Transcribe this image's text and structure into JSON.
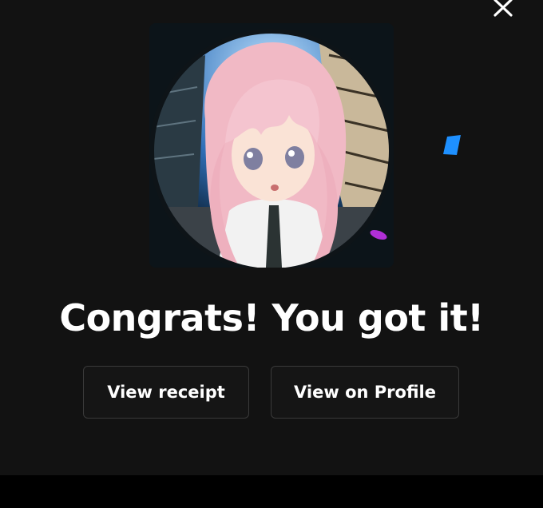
{
  "dialog": {
    "headline": "Congrats! You got it!",
    "close_icon": "close-icon"
  },
  "artwork": {
    "subject": "anime-girl-avatar"
  },
  "actions": {
    "view_receipt_label": "View receipt",
    "view_profile_label": "View on Profile"
  },
  "colors": {
    "background": "#121212",
    "text": "#ffffff",
    "button_border": "#3a3a3a",
    "confetti_blue": "#1e90ff",
    "confetti_pink": "#b02fd6"
  }
}
